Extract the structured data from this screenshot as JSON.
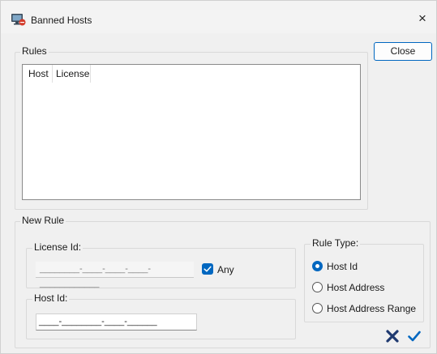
{
  "window": {
    "title": "Banned Hosts",
    "close_glyph": "×"
  },
  "rules": {
    "legend": "Rules",
    "columns": [
      "Host",
      "License"
    ],
    "rows": []
  },
  "buttons": {
    "close_label": "Close"
  },
  "new_rule": {
    "legend": "New Rule",
    "license": {
      "legend": "License Id:",
      "mask": "________-____-____-____-____________",
      "any_label": "Any",
      "any_checked": true
    },
    "host": {
      "legend": "Host Id:",
      "mask": "____-________-____-______"
    },
    "rule_type": {
      "legend": "Rule Type:",
      "options": [
        "Host Id",
        "Host Address",
        "Host Address Range"
      ],
      "selected": "Host Id"
    }
  },
  "colors": {
    "accent": "#0067c0",
    "cancel": "#1f3a70"
  },
  "icons": {
    "app": "banned-hosts-app-icon",
    "cancel": "cancel-x-icon",
    "confirm": "confirm-check-icon"
  }
}
